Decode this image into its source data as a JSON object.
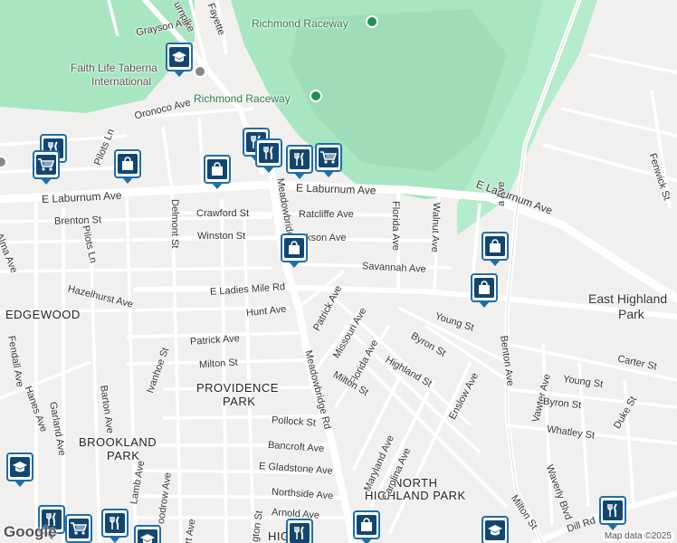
{
  "map": {
    "parks": [
      {
        "id": "raceway-top",
        "label": "Richmond Raceway"
      },
      {
        "id": "raceway-mid",
        "label": "Richmond Raceway"
      }
    ],
    "places": [
      {
        "id": "faith-life-1",
        "label": "Faith Life Taberna"
      },
      {
        "id": "faith-life-2",
        "label": "International"
      }
    ],
    "neighborhoods": [
      {
        "id": "edgewood",
        "label": "EDGEWOOD"
      },
      {
        "id": "providence-1",
        "label": "PROVIDENCE"
      },
      {
        "id": "providence-2",
        "label": "PARK"
      },
      {
        "id": "brookland-1",
        "label": "BROOKLAND"
      },
      {
        "id": "brookland-2",
        "label": "PARK"
      },
      {
        "id": "north-hp-1",
        "label": "NORTH"
      },
      {
        "id": "north-hp-2",
        "label": "HIGHLAND PARK"
      },
      {
        "id": "east-hp-1",
        "label": "East Highland"
      },
      {
        "id": "east-hp-2",
        "label": "Park"
      },
      {
        "id": "highland-partial",
        "label": "HIG"
      }
    ],
    "streets": [
      "Grayson Ave",
      "urnpike",
      "Fayette",
      "Oronoco Ave",
      "Pilots Ln",
      "E Laburnum Ave",
      "E Laburnum Ave",
      "E Laburnum Ave",
      "Brenton St",
      "Alma Ave",
      "Pilots Ln",
      "Delmont St",
      "Crawford St",
      "Ratcliffe Ave",
      "Winston St",
      "kson Ave",
      "Meadowbridge Rd",
      "Florida Ave",
      "Walnut Ave",
      "a Ave",
      "Savannah Ave",
      "Hazelhurst Ave",
      "E Ladies Mile Rd",
      "Hunt Ave",
      "Patrick Ave",
      "Missouri Ave",
      "Young St",
      "Byron St",
      "Fendall Ave",
      "Hanes Ave",
      "Ivanhoe St",
      "Patrick Ave",
      "Milton St",
      "Florida Ave",
      "Highland St",
      "Milton St",
      "Meadowbridge Rd",
      "Enslow Ave",
      "Benton Ave",
      "Carter St",
      "Young St",
      "Vawter Ave",
      "Byron St",
      "Duke St",
      "Whatley St",
      "Garland Ave",
      "Barton Ave",
      "Pollock St",
      "Maryland Ave",
      "Carolina Ave",
      "Bancroft Ave",
      "E Gladstone Ave",
      "Lamb Ave",
      "oodrow Ave",
      "Northside Ave",
      "Arnold Ave",
      "gton St",
      "Milton St",
      "Waverly Blvd",
      "Dill Rd",
      "Fenwick St",
      "rt Ave"
    ],
    "attribution": "Map data ©2025",
    "logo": "Google",
    "colors": {
      "background": "#f2f0ee",
      "park": "#a8e6c1",
      "park_dark": "#8fd9ad",
      "road": "#ffffff",
      "pin_border": "#1e6ea8",
      "pin_fill": "#12466f"
    }
  },
  "markers": [
    {
      "id": "school-1",
      "icon": "graduation-cap-icon"
    },
    {
      "id": "restaurant-1",
      "icon": "fork-knife-icon"
    },
    {
      "id": "restaurant-2",
      "icon": "fork-knife-icon"
    },
    {
      "id": "restaurant-3",
      "icon": "fork-knife-icon"
    },
    {
      "id": "grocery-1",
      "icon": "shopping-cart-icon"
    },
    {
      "id": "store-1",
      "icon": "shopping-bag-icon"
    },
    {
      "id": "store-2",
      "icon": "shopping-bag-icon"
    },
    {
      "id": "store-3",
      "icon": "shopping-bag-icon"
    },
    {
      "id": "restaurant-4",
      "icon": "fork-knife-icon"
    },
    {
      "id": "grocery-2",
      "icon": "shopping-cart-icon"
    },
    {
      "id": "store-4",
      "icon": "shopping-bag-icon"
    },
    {
      "id": "store-5",
      "icon": "shopping-bag-icon"
    },
    {
      "id": "school-2",
      "icon": "graduation-cap-icon"
    },
    {
      "id": "restaurant-5",
      "icon": "fork-knife-icon"
    },
    {
      "id": "store-6",
      "icon": "shopping-bag-icon"
    },
    {
      "id": "school-3",
      "icon": "graduation-cap-icon"
    },
    {
      "id": "restaurant-6",
      "icon": "fork-knife-icon"
    },
    {
      "id": "restaurant-7",
      "icon": "fork-knife-icon"
    },
    {
      "id": "grocery-3",
      "icon": "shopping-cart-icon"
    },
    {
      "id": "restaurant-8",
      "icon": "fork-knife-icon"
    },
    {
      "id": "school-4",
      "icon": "graduation-cap-icon"
    }
  ]
}
